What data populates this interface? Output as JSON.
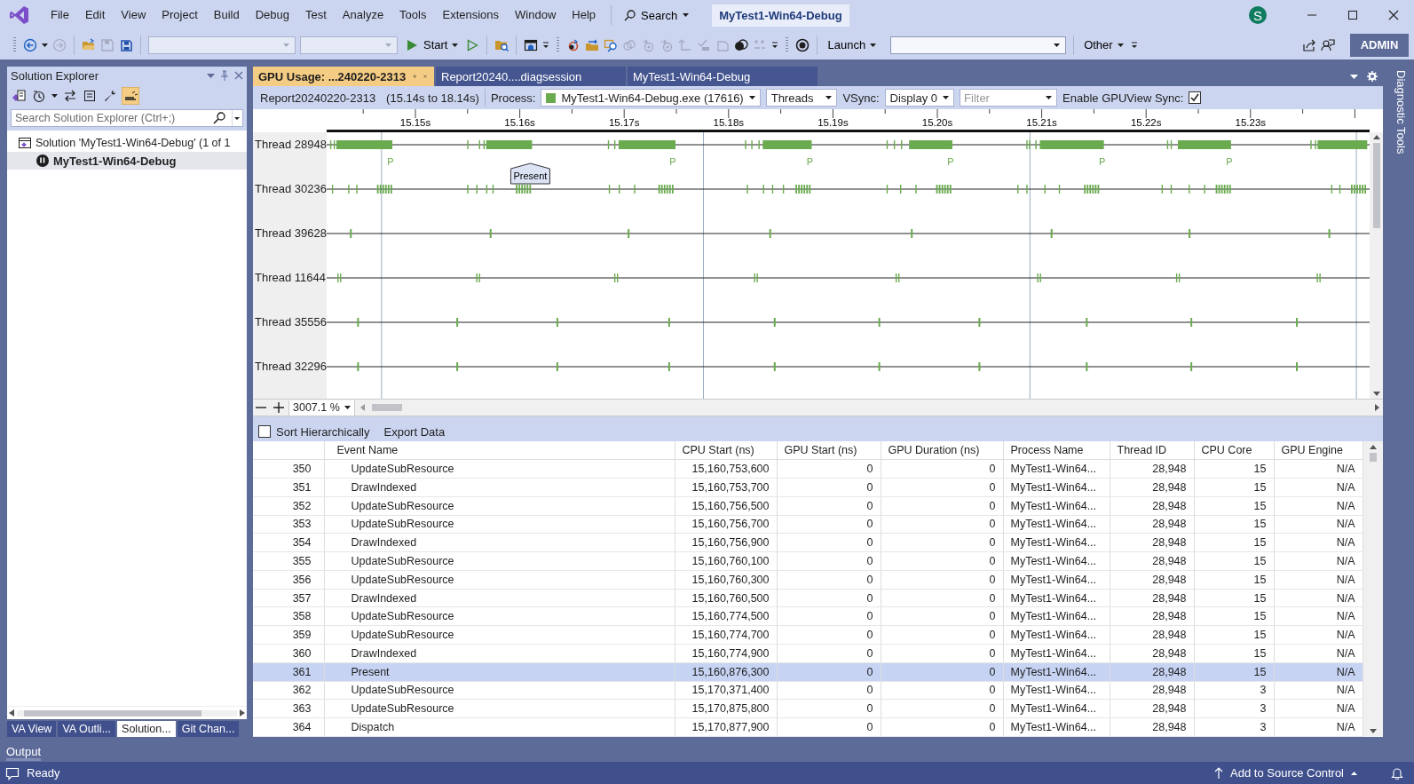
{
  "title_bar": {
    "menu": [
      "File",
      "Edit",
      "View",
      "Project",
      "Build",
      "Debug",
      "Test",
      "Analyze",
      "Tools",
      "Extensions",
      "Window",
      "Help"
    ],
    "search": "Search",
    "solution_name": "MyTest1-Win64-Debug",
    "avatar": "S"
  },
  "toolbar": {
    "start": "Start",
    "launch": "Launch",
    "other": "Other",
    "admin": "ADMIN"
  },
  "solution_explorer": {
    "title": "Solution Explorer",
    "search_placeholder": "Search Solution Explorer (Ctrl+;)",
    "tree": [
      {
        "label": "Solution 'MyTest1-Win64-Debug' (1 of 1",
        "selected": false,
        "children": [
          {
            "label": "MyTest1-Win64-Debug",
            "selected": true
          }
        ]
      }
    ],
    "tabs": [
      {
        "label": "VA View",
        "selected": false
      },
      {
        "label": "VA Outli...",
        "selected": false
      },
      {
        "label": "Solution...",
        "selected": true
      },
      {
        "label": "Git Chan...",
        "selected": false
      }
    ]
  },
  "document_tabs": [
    {
      "label": "GPU Usage: ...240220-2313",
      "selected": true
    },
    {
      "label": "Report20240....diagsession",
      "selected": false
    },
    {
      "label": "MyTest1-Win64-Debug",
      "selected": false
    }
  ],
  "report_bar": {
    "report": "Report20240220-2313",
    "range": "(15.14s to 18.14s)",
    "process_label": "Process:",
    "process": "MyTest1-Win64-Debug.exe (17616)",
    "view": "Threads",
    "vsync_label": "VSync:",
    "vsync": "Display 0",
    "filter_placeholder": "Filter",
    "gpuview_label": "Enable GPUView Sync:",
    "gpuview_sync": true
  },
  "timeline": {
    "ticks": [
      "15.15s",
      "15.16s",
      "15.17s",
      "15.18s",
      "15.19s",
      "15.20s",
      "15.21s",
      "15.22s",
      "15.23s"
    ],
    "callout": "Present",
    "threads": [
      {
        "label": "Thread 28948",
        "markers": [
          "P",
          "P",
          "P",
          "P",
          "P",
          "P"
        ]
      },
      {
        "label": "Thread 30236"
      },
      {
        "label": "Thread 39628"
      },
      {
        "label": "Thread 11644"
      },
      {
        "label": "Thread 35556"
      },
      {
        "label": "Thread 32296"
      }
    ]
  },
  "zoom": {
    "value": "3007.1 %"
  },
  "table": {
    "sort_hierarchically": false,
    "sort_label": "Sort Hierarchically",
    "export": "Export Data",
    "columns": [
      "Event Name",
      "CPU Start (ns)",
      "GPU Start (ns)",
      "GPU Duration (ns)",
      "Process Name",
      "Thread ID",
      "CPU Core",
      "GPU Engine"
    ],
    "rows": [
      {
        "index": "350",
        "cells": [
          "UpdateSubResource",
          "15,160,753,600",
          "0",
          "0",
          "MyTest1-Win64...",
          "28,948",
          "15",
          "N/A"
        ],
        "selected": false
      },
      {
        "index": "351",
        "cells": [
          "DrawIndexed",
          "15,160,753,700",
          "0",
          "0",
          "MyTest1-Win64...",
          "28,948",
          "15",
          "N/A"
        ],
        "selected": false
      },
      {
        "index": "352",
        "cells": [
          "UpdateSubResource",
          "15,160,756,500",
          "0",
          "0",
          "MyTest1-Win64...",
          "28,948",
          "15",
          "N/A"
        ],
        "selected": false
      },
      {
        "index": "353",
        "cells": [
          "UpdateSubResource",
          "15,160,756,700",
          "0",
          "0",
          "MyTest1-Win64...",
          "28,948",
          "15",
          "N/A"
        ],
        "selected": false
      },
      {
        "index": "354",
        "cells": [
          "DrawIndexed",
          "15,160,756,900",
          "0",
          "0",
          "MyTest1-Win64...",
          "28,948",
          "15",
          "N/A"
        ],
        "selected": false
      },
      {
        "index": "355",
        "cells": [
          "UpdateSubResource",
          "15,160,760,100",
          "0",
          "0",
          "MyTest1-Win64...",
          "28,948",
          "15",
          "N/A"
        ],
        "selected": false
      },
      {
        "index": "356",
        "cells": [
          "UpdateSubResource",
          "15,160,760,300",
          "0",
          "0",
          "MyTest1-Win64...",
          "28,948",
          "15",
          "N/A"
        ],
        "selected": false
      },
      {
        "index": "357",
        "cells": [
          "DrawIndexed",
          "15,160,760,500",
          "0",
          "0",
          "MyTest1-Win64...",
          "28,948",
          "15",
          "N/A"
        ],
        "selected": false
      },
      {
        "index": "358",
        "cells": [
          "UpdateSubResource",
          "15,160,774,500",
          "0",
          "0",
          "MyTest1-Win64...",
          "28,948",
          "15",
          "N/A"
        ],
        "selected": false
      },
      {
        "index": "359",
        "cells": [
          "UpdateSubResource",
          "15,160,774,700",
          "0",
          "0",
          "MyTest1-Win64...",
          "28,948",
          "15",
          "N/A"
        ],
        "selected": false
      },
      {
        "index": "360",
        "cells": [
          "DrawIndexed",
          "15,160,774,900",
          "0",
          "0",
          "MyTest1-Win64...",
          "28,948",
          "15",
          "N/A"
        ],
        "selected": false
      },
      {
        "index": "361",
        "cells": [
          "Present",
          "15,160,876,300",
          "0",
          "0",
          "MyTest1-Win64...",
          "28,948",
          "15",
          "N/A"
        ],
        "selected": true
      },
      {
        "index": "362",
        "cells": [
          "UpdateSubResource",
          "15,170,371,400",
          "0",
          "0",
          "MyTest1-Win64...",
          "28,948",
          "3",
          "N/A"
        ],
        "selected": false
      },
      {
        "index": "363",
        "cells": [
          "UpdateSubResource",
          "15,170,875,800",
          "0",
          "0",
          "MyTest1-Win64...",
          "28,948",
          "3",
          "N/A"
        ],
        "selected": false
      },
      {
        "index": "364",
        "cells": [
          "Dispatch",
          "15,170,877,900",
          "0",
          "0",
          "MyTest1-Win64...",
          "28,948",
          "3",
          "N/A"
        ],
        "selected": false
      }
    ]
  },
  "side_tab": "Diagnostic Tools",
  "output": "Output",
  "status_bar": {
    "text": "Ready",
    "source_control": "Add to Source Control"
  }
}
